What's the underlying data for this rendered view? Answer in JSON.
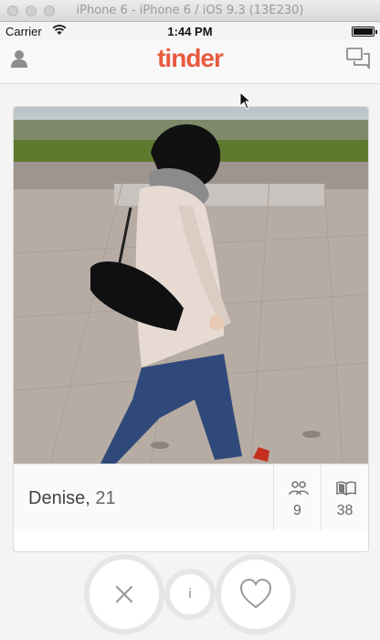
{
  "window": {
    "title": "iPhone 6 - iPhone 6 / iOS 9.3 (13E230)"
  },
  "statusbar": {
    "carrier": "Carrier",
    "time": "1:44 PM"
  },
  "navbar": {
    "logo_text": "tinder",
    "brand_color": "#e85a3f"
  },
  "card": {
    "name": "Denise,",
    "age": "21",
    "stats": [
      {
        "icon": "friends-icon",
        "value": "9"
      },
      {
        "icon": "book-icon",
        "value": "38"
      }
    ]
  },
  "actions": {
    "info_label": "i"
  }
}
